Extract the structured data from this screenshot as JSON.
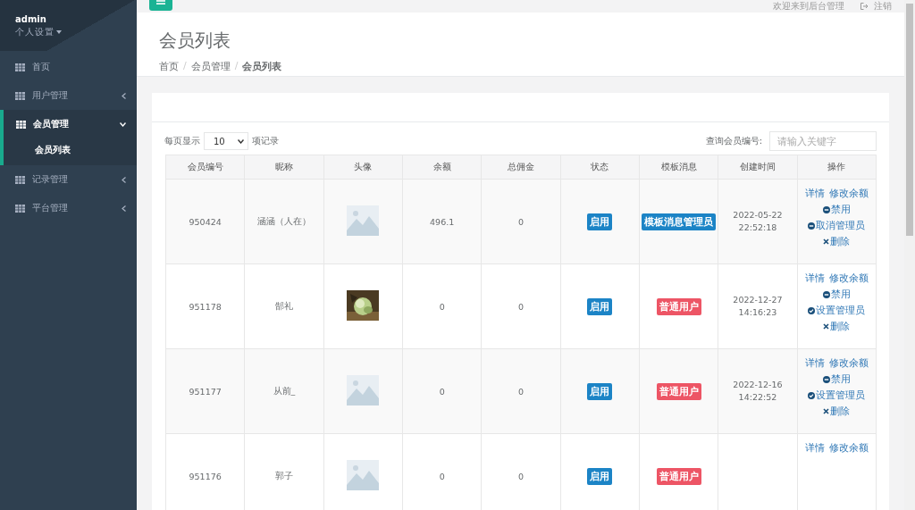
{
  "sidebar": {
    "user": "admin",
    "settings": "个人设置",
    "items": [
      {
        "label": "首页",
        "kind": "link",
        "selected": false
      },
      {
        "label": "用户管理",
        "kind": "group",
        "expanded": false,
        "selected": false
      },
      {
        "label": "会员管理",
        "kind": "group",
        "expanded": true,
        "selected": true,
        "children": [
          {
            "label": "会员列表",
            "selected": true
          }
        ]
      },
      {
        "label": "记录管理",
        "kind": "group",
        "expanded": false,
        "selected": false
      },
      {
        "label": "平台管理",
        "kind": "group",
        "expanded": false,
        "selected": false
      }
    ]
  },
  "topbar": {
    "welcome": "欢迎来到后台管理",
    "logout": "注销"
  },
  "page": {
    "title": "会员列表",
    "breadcrumb": [
      {
        "label": "首页",
        "separator": "/"
      },
      {
        "label": "会员管理",
        "separator": "/"
      },
      {
        "label": "会员列表"
      }
    ]
  },
  "controls": {
    "page_size_prefix": "每页显示",
    "page_size": "10",
    "page_size_suffix": "项记录",
    "search_label": "查询会员编号:",
    "search_placeholder": "请输入关键字"
  },
  "table": {
    "columns": [
      "会员编号",
      "昵称",
      "头像",
      "余额",
      "总佣金",
      "状态",
      "模板消息",
      "创建时间",
      "操作"
    ],
    "rows": [
      {
        "id": "950424",
        "nickname": "涵涵（人在）",
        "avatar": {
          "kind": "placeholder"
        },
        "balance": "496.1",
        "commission": "0",
        "status": {
          "label": "启用",
          "kind": "enabled"
        },
        "template": {
          "label": "模板消息管理员",
          "kind": "admin"
        },
        "created": [
          "2022-05-22",
          "22:52:18"
        ],
        "actions": [
          {
            "label": "详情",
            "kind": "link"
          },
          {
            "label": "修改余额",
            "kind": "link"
          },
          {
            "label": "禁用",
            "kind": "minus"
          },
          {
            "label": "取消管理员",
            "kind": "minus"
          },
          {
            "label": "删除",
            "kind": "times"
          }
        ]
      },
      {
        "id": "951178",
        "nickname": "郜礼",
        "avatar": {
          "kind": "picture"
        },
        "balance": "0",
        "commission": "0",
        "status": {
          "label": "启用",
          "kind": "enabled"
        },
        "template": {
          "label": "普通用户",
          "kind": "user"
        },
        "created": [
          "2022-12-27",
          "14:16:23"
        ],
        "actions": [
          {
            "label": "详情",
            "kind": "link"
          },
          {
            "label": "修改余额",
            "kind": "link"
          },
          {
            "label": "禁用",
            "kind": "minus"
          },
          {
            "label": "设置管理员",
            "kind": "check"
          },
          {
            "label": "删除",
            "kind": "times"
          }
        ]
      },
      {
        "id": "951177",
        "nickname": "从前_",
        "avatar": {
          "kind": "placeholder"
        },
        "balance": "0",
        "commission": "0",
        "status": {
          "label": "启用",
          "kind": "enabled"
        },
        "template": {
          "label": "普通用户",
          "kind": "user"
        },
        "created": [
          "2022-12-16",
          "14:22:52"
        ],
        "actions": [
          {
            "label": "详情",
            "kind": "link"
          },
          {
            "label": "修改余额",
            "kind": "link"
          },
          {
            "label": "禁用",
            "kind": "minus"
          },
          {
            "label": "设置管理员",
            "kind": "check"
          },
          {
            "label": "删除",
            "kind": "times"
          }
        ]
      },
      {
        "id": "951176",
        "nickname": "郭子",
        "avatar": {
          "kind": "placeholder"
        },
        "balance": "0",
        "commission": "0",
        "status": {
          "label": "启用",
          "kind": "enabled"
        },
        "template": {
          "label": "普通用户",
          "kind": "user"
        },
        "created": [],
        "actions": [
          {
            "label": "详情",
            "kind": "link"
          },
          {
            "label": "修改余额",
            "kind": "link"
          }
        ]
      }
    ]
  }
}
